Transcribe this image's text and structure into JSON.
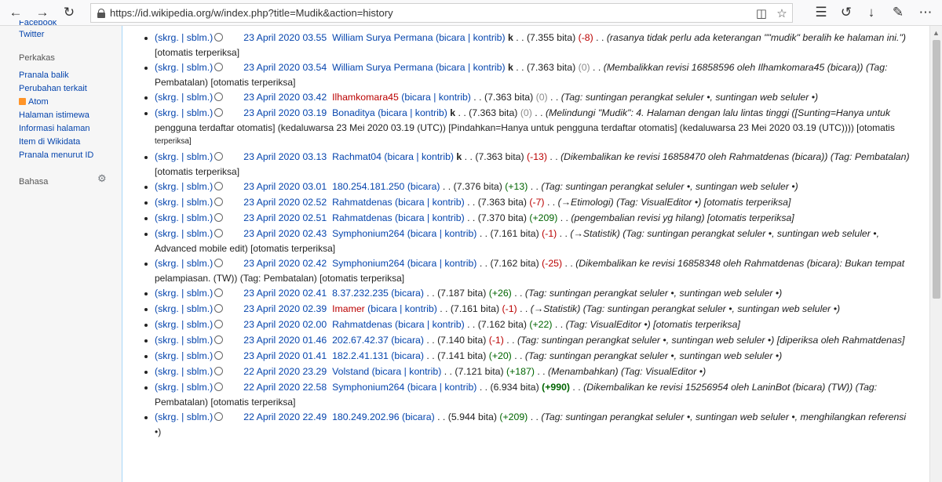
{
  "browser": {
    "url": "https://id.wikipedia.org/w/index.php?title=Mudik&action=history"
  },
  "sidebar": {
    "partial": "Facebook",
    "twitter": "Twitter",
    "tools_heading": "Perkakas",
    "tools": [
      "Pranala balik",
      "Perubahan terkait",
      "Atom",
      "Halaman istimewa",
      "Informasi halaman",
      "Item di Wikidata",
      "Pranala menurut ID"
    ],
    "lang_heading": "Bahasa"
  },
  "rows": [
    {
      "date": "23 April 2020 03.55",
      "user": "William Surya Permana",
      "ulinks": " (bicara | kontrib) ",
      "minor": "k",
      "size": "(7.355 bita)",
      "diff": "(-8)",
      "dc": "red",
      "comment": "(rasanya tidak perlu ada keterangan \"\"mudik\" beralih ke halaman ini.\")",
      "line2": "[otomatis terperiksa]"
    },
    {
      "date": "23 April 2020 03.54",
      "user": "William Surya Permana",
      "ulinks": " (bicara | kontrib) ",
      "minor": "k",
      "size": "(7.363 bita)",
      "diff": "(0)",
      "dc": "gry",
      "comment": "(Membalikkan revisi 16858596 oleh Ilhamkomara45 (bicara)) (Tag:",
      "line2": "Pembatalan) [otomatis terperiksa]"
    },
    {
      "date": "23 April 2020 03.42",
      "user": "Ilhamkomara45",
      "uc": "red",
      "ulinks": " (bicara | kontrib) ",
      "minor": "",
      "size": "(7.363 bita)",
      "diff": "(0)",
      "dc": "gry",
      "comment": "(Tag: suntingan perangkat seluler •, suntingan web seluler •)",
      "line2": ""
    },
    {
      "date": "23 April 2020 03.19",
      "user": "Bonaditya",
      "ulinks": " (bicara | kontrib) ",
      "minor": "k",
      "size": "(7.363 bita)",
      "diff": "(0)",
      "dc": "gry",
      "comment": "(Melindungi \"Mudik\": 4. Halaman dengan lalu lintas tinggi ([Sunting=Hanya untuk",
      "line2": "pengguna terdaftar otomatis] (kedaluwarsa 23 Mei 2020 03.19 (UTC)) [Pindahkan=Hanya untuk pengguna terdaftar otomatis] (kedaluwarsa 23 Mei 2020 03.19 (UTC)))) [otomatis",
      "line3": "terperiksa]"
    },
    {
      "date": "23 April 2020 03.13",
      "user": "Rachmat04",
      "ulinks": " (bicara | kontrib) ",
      "minor": "k",
      "size": "(7.363 bita)",
      "diff": "(-13)",
      "dc": "red",
      "comment": "(Dikembalikan ke revisi 16858470 oleh Rahmatdenas (bicara)) (Tag: Pembatalan)",
      "line2": "[otomatis terperiksa]"
    },
    {
      "date": "23 April 2020 03.01",
      "user": "180.254.181.250",
      "ulinks": " (bicara) ",
      "minor": "",
      "size": "(7.376 bita)",
      "diff": "(+13)",
      "dc": "grn",
      "comment": "(Tag: suntingan perangkat seluler •, suntingan web seluler •)",
      "line2": ""
    },
    {
      "date": "23 April 2020 02.52",
      "user": "Rahmatdenas",
      "ulinks": " (bicara | kontrib) ",
      "minor": "",
      "size": "(7.363 bita)",
      "diff": "(-7)",
      "dc": "red",
      "comment": "(→Etimologi) (Tag: VisualEditor •) [otomatis terperiksa]",
      "line2": ""
    },
    {
      "date": "23 April 2020 02.51",
      "user": "Rahmatdenas",
      "ulinks": " (bicara | kontrib) ",
      "minor": "",
      "size": "(7.370 bita)",
      "diff": "(+209)",
      "dc": "grn",
      "comment": "(pengembalian revisi yg hilang) [otomatis terperiksa]",
      "line2": ""
    },
    {
      "date": "23 April 2020 02.43",
      "user": "Symphonium264",
      "ulinks": " (bicara | kontrib) ",
      "minor": "",
      "size": "(7.161 bita)",
      "diff": "(-1)",
      "dc": "red",
      "comment": "(→Statistik) (Tag: suntingan perangkat seluler •, suntingan web seluler •,",
      "line2": "Advanced mobile edit) [otomatis terperiksa]"
    },
    {
      "date": "23 April 2020 02.42",
      "user": "Symphonium264",
      "ulinks": " (bicara | kontrib) ",
      "minor": "",
      "size": "(7.162 bita)",
      "diff": "(-25)",
      "dc": "red",
      "comment": "(Dikembalikan ke revisi 16858348 oleh Rahmatdenas (bicara): Bukan tempat",
      "line2": "pelampiasan. (TW)) (Tag: Pembatalan) [otomatis terperiksa]"
    },
    {
      "date": "23 April 2020 02.41",
      "user": "8.37.232.235",
      "ulinks": " (bicara) ",
      "minor": "",
      "size": "(7.187 bita)",
      "diff": "(+26)",
      "dc": "grn",
      "comment": "(Tag: suntingan perangkat seluler •, suntingan web seluler •)",
      "line2": ""
    },
    {
      "date": "23 April 2020 02.39",
      "user": "Imamer",
      "uc": "red",
      "ulinks": " (bicara | kontrib) ",
      "minor": "",
      "size": "(7.161 bita)",
      "diff": "(-1)",
      "dc": "red",
      "comment": "(→Statistik) (Tag: suntingan perangkat seluler •, suntingan web seluler •)",
      "line2": ""
    },
    {
      "date": "23 April 2020 02.00",
      "user": "Rahmatdenas",
      "ulinks": " (bicara | kontrib) ",
      "minor": "",
      "size": "(7.162 bita)",
      "diff": "(+22)",
      "dc": "grn",
      "comment": "(Tag: VisualEditor •) [otomatis terperiksa]",
      "line2": ""
    },
    {
      "date": "23 April 2020 01.46",
      "user": "202.67.42.37",
      "ulinks": " (bicara) ",
      "minor": "",
      "size": "(7.140 bita)",
      "diff": "(-1)",
      "dc": "red",
      "comment": "(Tag: suntingan perangkat seluler •, suntingan web seluler •) [diperiksa oleh Rahmatdenas]",
      "line2": ""
    },
    {
      "date": "23 April 2020 01.41",
      "user": "182.2.41.131",
      "ulinks": " (bicara) ",
      "minor": "",
      "size": "(7.141 bita)",
      "diff": "(+20)",
      "dc": "grn",
      "comment": "(Tag: suntingan perangkat seluler •, suntingan web seluler •)",
      "line2": ""
    },
    {
      "date": "22 April 2020 23.29",
      "user": "Volstand",
      "ulinks": " (bicara | kontrib) ",
      "minor": "",
      "size": "(7.121 bita)",
      "diff": "(+187)",
      "dc": "grn",
      "comment": "(Menambahkan) (Tag: VisualEditor •)",
      "line2": ""
    },
    {
      "date": "22 April 2020 22.58",
      "user": "Symphonium264",
      "ulinks": " (bicara | kontrib) ",
      "minor": "",
      "size": "(6.934 bita)",
      "diff": "(+990)",
      "dc": "grn",
      "bd": true,
      "comment": "(Dikembalikan ke revisi 15256954 oleh LaninBot (bicara) (TW)) (Tag:",
      "line2": "Pembatalan) [otomatis terperiksa]"
    },
    {
      "date": "22 April 2020 22.49",
      "user": "180.249.202.96",
      "ulinks": " (bicara) ",
      "minor": "",
      "size": "(5.944 bita)",
      "diff": "(+209)",
      "dc": "grn",
      "comment": "(Tag: suntingan perangkat seluler •, suntingan web seluler •, menghilangkan referensi",
      "line2": "•)"
    }
  ],
  "row_labels": {
    "cur_prev": "(skrg. | sblm.)"
  }
}
